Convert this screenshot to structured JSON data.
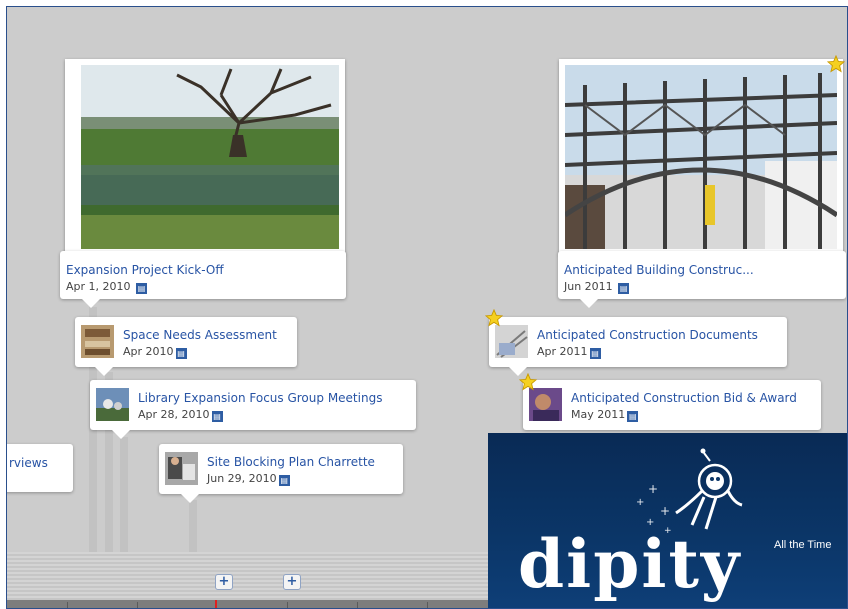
{
  "events": {
    "kickoff": {
      "title": "Expansion Project Kick-Off",
      "date": "Apr 1, 2010"
    },
    "building": {
      "title": "Anticipated Building Construc...",
      "date": "Jun 2011"
    },
    "space": {
      "title": "Space Needs Assessment",
      "date": "Apr 2010"
    },
    "focus": {
      "title": "Library Expansion Focus Group Meetings",
      "date": "Apr 28, 2010"
    },
    "site": {
      "title": "Site Blocking Plan Charrette",
      "date": "Jun 29, 2010"
    },
    "interviews": {
      "title": "rviews"
    },
    "docs": {
      "title": "Anticipated Construction Documents",
      "date": "Apr 2011"
    },
    "bid": {
      "title": "Anticipated Construction Bid & Award",
      "date": "May 2011"
    }
  },
  "icons": {
    "tag": "media-tag-icon",
    "featured": "star-icon",
    "expand": "plus-icon"
  },
  "zoom_controls": {
    "plus_symbol": "+"
  },
  "ad": {
    "logo": "dipity",
    "tagline": "All the Time"
  },
  "colors": {
    "link": "#2753a4",
    "background": "#cccccc",
    "ad_bg": "#0b3668",
    "frame_border": "#2a4f8c"
  }
}
